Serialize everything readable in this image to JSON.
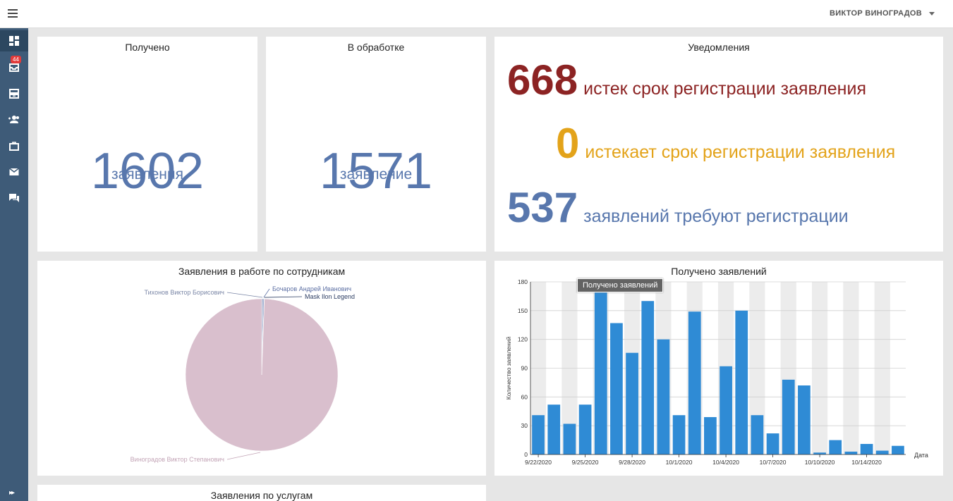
{
  "topbar": {
    "user_name": "ВИКТОР ВИНОГРАДОВ"
  },
  "sidebar": {
    "items": [
      {
        "icon": "dashboard-icon"
      },
      {
        "icon": "inbox-icon",
        "badge": "44"
      },
      {
        "icon": "archive-icon"
      },
      {
        "icon": "add-users-icon"
      },
      {
        "icon": "briefcase-icon"
      },
      {
        "icon": "mail-icon"
      },
      {
        "icon": "chat-icon"
      }
    ],
    "expand_label": "▸▸"
  },
  "received": {
    "title": "Получено",
    "value": "1602",
    "label": "заявления"
  },
  "in_progress": {
    "title": "В обработке",
    "value": "1571",
    "label": "заявление"
  },
  "notifications": {
    "title": "Уведомления",
    "rows": [
      {
        "value": "668",
        "text": "истек срок регистрации заявления",
        "color": "#8c2323"
      },
      {
        "value": "0",
        "text": "истекает срок регистрации заявления",
        "color": "#e3a31a"
      },
      {
        "value": "537",
        "text": "заявлений требуют регистрации",
        "color": "#5877ad"
      }
    ]
  },
  "employees_card": {
    "title": "Заявления в работе по сотрудникам"
  },
  "received_chart_card": {
    "title": "Получено заявлений",
    "tooltip": "Получено заявлений"
  },
  "services_card": {
    "title": "Заявления по услугам"
  },
  "chart_data": [
    {
      "type": "pie",
      "title": "Заявления в работе по сотрудникам",
      "slices": [
        {
          "label": "Виноградов Виктор Степанович",
          "value": 1562,
          "color": "#d9bfcd"
        },
        {
          "label": "Тихонов Виктор Борисович",
          "value": 5,
          "color": "#9aa7c6"
        },
        {
          "label": "Бочаров Андрей Иванович",
          "value": 3,
          "color": "#6e85ba"
        },
        {
          "label": "Mask Ilon Legend",
          "value": 1,
          "color": "#2d3e63"
        }
      ]
    },
    {
      "type": "bar",
      "title": "Получено заявлений",
      "xlabel": "Дата",
      "ylabel": "Количество заявлений",
      "ylim": [
        0,
        180
      ],
      "yticks": [
        0,
        30,
        60,
        90,
        120,
        150,
        180
      ],
      "x_tick_labels": [
        "9/22/2020",
        "9/25/2020",
        "9/28/2020",
        "10/1/2020",
        "10/4/2020",
        "10/7/2020",
        "10/10/2020",
        "10/14/2020"
      ],
      "x_tick_indices": [
        0,
        3,
        6,
        9,
        12,
        15,
        18,
        21
      ],
      "values": [
        41,
        52,
        32,
        52,
        170,
        137,
        106,
        160,
        120,
        41,
        149,
        39,
        92,
        150,
        41,
        22,
        78,
        72,
        2,
        15,
        3,
        11,
        4,
        9
      ],
      "bar_color": "#2f8bd5"
    }
  ]
}
